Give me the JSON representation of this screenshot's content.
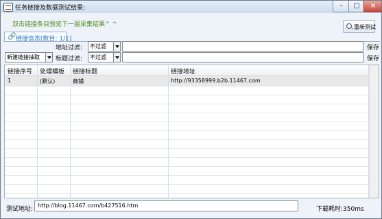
{
  "window": {
    "title": "任务链接及数据测试结果:"
  },
  "hint": "双击链接条目预览下一层采集结果^ ^",
  "retest_label": "重新测试",
  "tab": {
    "label": "链接信息[数目: 1/1]"
  },
  "filters": {
    "address_label": "地址过滤:",
    "address_mode": "不过滤",
    "title_label": "标题过滤:",
    "title_mode": "不过滤",
    "save_label": "保存",
    "save_label_2": "保存",
    "extract_mode": "新建链接抽取"
  },
  "table": {
    "columns": [
      "链接序号",
      "处理模板",
      "链接标题",
      "链接地址"
    ],
    "rows": [
      [
        "1",
        "(默认)",
        "商铺",
        "http://93358999.b2b.11467.com"
      ]
    ]
  },
  "bottom": {
    "test_label": "测试地址:",
    "test_url": "http://blog.11467.com/b427516.htm",
    "timing": "下载耗时:350ms"
  }
}
